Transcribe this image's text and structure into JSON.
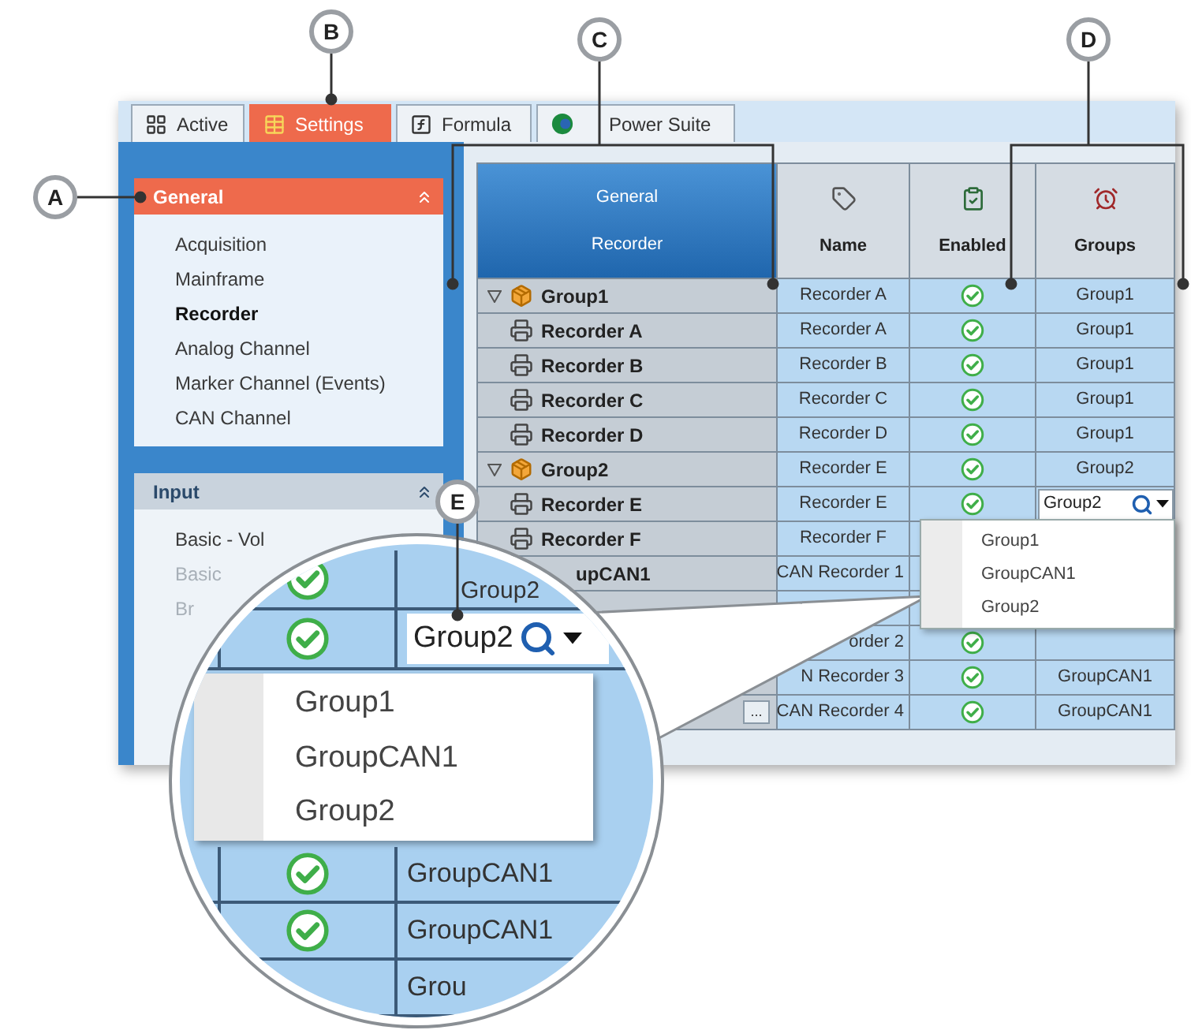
{
  "callouts": [
    {
      "label": "A"
    },
    {
      "label": "B"
    },
    {
      "label": "C"
    },
    {
      "label": "D"
    },
    {
      "label": "E"
    }
  ],
  "tabs": [
    {
      "label": "Active",
      "selected": false
    },
    {
      "label": "Settings",
      "selected": true
    },
    {
      "label": "Formula",
      "selected": false
    },
    {
      "label": "Power Suite",
      "selected": false
    }
  ],
  "sidebar": {
    "sections": [
      {
        "title": "General",
        "selected": true,
        "expanded": true,
        "items": [
          {
            "label": "Acquisition",
            "selected": false,
            "disabled": false
          },
          {
            "label": "Mainframe",
            "selected": false,
            "disabled": false
          },
          {
            "label": "Recorder",
            "selected": true,
            "disabled": false
          },
          {
            "label": "Analog Channel",
            "selected": false,
            "disabled": false
          },
          {
            "label": "Marker Channel (Events)",
            "selected": false,
            "disabled": false
          },
          {
            "label": "CAN Channel",
            "selected": false,
            "disabled": false
          }
        ]
      },
      {
        "title": "Input",
        "selected": false,
        "expanded": true,
        "items": [
          {
            "label": "Basic - Vol",
            "selected": false,
            "disabled": false
          },
          {
            "label": "Basic",
            "selected": false,
            "disabled": true
          },
          {
            "label": "Br",
            "selected": false,
            "disabled": true
          }
        ]
      }
    ]
  },
  "grid": {
    "header_lines": [
      "General",
      "Recorder"
    ],
    "columns": [
      {
        "label": "Name"
      },
      {
        "label": "Enabled"
      },
      {
        "label": "Groups"
      }
    ],
    "rows": [
      {
        "kind": "group",
        "label": "Group1",
        "expanded": true,
        "name": "Recorder A",
        "enabled": true,
        "groups": "Group1"
      },
      {
        "kind": "recorder",
        "label": "Recorder A",
        "name": "Recorder A",
        "enabled": true,
        "groups": "Group1"
      },
      {
        "kind": "recorder",
        "label": "Recorder B",
        "name": "Recorder B",
        "enabled": true,
        "groups": "Group1"
      },
      {
        "kind": "recorder",
        "label": "Recorder C",
        "name": "Recorder C",
        "enabled": true,
        "groups": "Group1"
      },
      {
        "kind": "recorder",
        "label": "Recorder D",
        "name": "Recorder D",
        "enabled": true,
        "groups": "Group1"
      },
      {
        "kind": "group",
        "label": "Group2",
        "expanded": true,
        "name": "Recorder E",
        "enabled": true,
        "groups": "Group2"
      },
      {
        "kind": "recorder",
        "label": "Recorder E",
        "name": "Recorder E",
        "enabled": true,
        "groups_field": {
          "value": "Group2"
        }
      },
      {
        "kind": "recorder",
        "label": "Recorder F",
        "name": "Recorder F"
      },
      {
        "kind": "cut",
        "label": "upCAN1",
        "name": "CAN Recorder 1"
      },
      {
        "kind": "cut"
      },
      {
        "kind": "cut",
        "name": "order 2",
        "enabled": true
      },
      {
        "kind": "cut",
        "name": "N Recorder 3",
        "enabled": true,
        "groups": "GroupCAN1"
      },
      {
        "kind": "cut",
        "name": "CAN Recorder 4",
        "button": "...",
        "enabled": true,
        "groups": "GroupCAN1"
      }
    ],
    "dropdown": {
      "options": [
        {
          "label": "Group1"
        },
        {
          "label": "GroupCAN1"
        },
        {
          "label": "Group2"
        }
      ]
    }
  },
  "magnifier": {
    "rows_above": [
      {
        "enabled": true,
        "groups": "Group2"
      },
      {
        "enabled": true,
        "field": "Group2"
      }
    ],
    "dropdown": {
      "options": [
        {
          "label": "Group1"
        },
        {
          "label": "GroupCAN1"
        },
        {
          "label": "Group2"
        }
      ]
    },
    "rows_below": [
      {
        "enabled": true,
        "groups": "GroupCAN1"
      },
      {
        "enabled": true,
        "groups": "GroupCAN1"
      },
      {
        "groups": "Grou"
      }
    ]
  }
}
